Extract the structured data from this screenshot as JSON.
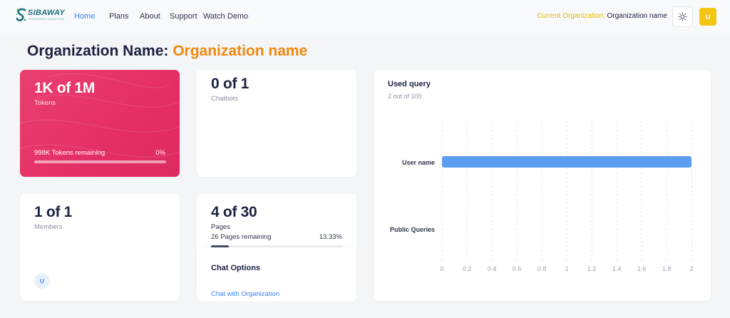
{
  "nav": {
    "logo_text": "SIBAWAY",
    "logo_sub": "AI ASSISTANTS & SOLUTIONS",
    "links": [
      {
        "label": "Home",
        "active": true
      },
      {
        "label": "Plans"
      },
      {
        "label": "About"
      },
      {
        "label": "Support"
      },
      {
        "label": "Watch Demo"
      }
    ],
    "current_org_label": "Current Organization:",
    "current_org_value": "Organization name",
    "theme_icon": "sun-icon",
    "avatar_initial": "U"
  },
  "header": {
    "prefix": "Organization Name:",
    "org_name": "Organization name"
  },
  "tokens_card": {
    "value": "1K of 1M",
    "label": "Tokens",
    "remaining": "998K Tokens remaining",
    "percent": "0%",
    "progress": 0.0
  },
  "chatbots_card": {
    "value": "0 of 1",
    "label": "Chatbots"
  },
  "members_card": {
    "value": "1 of 1",
    "label": "Members",
    "member_initial": "U"
  },
  "pages_card": {
    "value": "4 of 30",
    "label": "Pages",
    "remaining": "26 Pages remaining",
    "percent": "13.33%",
    "progress": 0.1333
  },
  "chat_options": {
    "title": "Chat Options",
    "link": "Chat with Organization"
  },
  "query_card": {
    "title": "Used query",
    "subtitle": "2 out of 100"
  },
  "colors": {
    "accent": "#3b82f6",
    "brand_orange": "#f0890f",
    "pink": "#e42f66",
    "yellow": "#f3c512",
    "bar": "#5b9ef0"
  },
  "chart_data": {
    "type": "bar",
    "orientation": "horizontal",
    "title": "Used query",
    "subtitle": "2 out of 100",
    "categories": [
      "User name",
      "Public Queries"
    ],
    "values": [
      2,
      0
    ],
    "xlim": [
      0,
      2
    ],
    "xticks": [
      "0",
      "0.2",
      "0.4",
      "0.6",
      "0.8",
      "1",
      "1.2",
      "1.4",
      "1.6",
      "1.8",
      "2"
    ],
    "grid": true
  }
}
